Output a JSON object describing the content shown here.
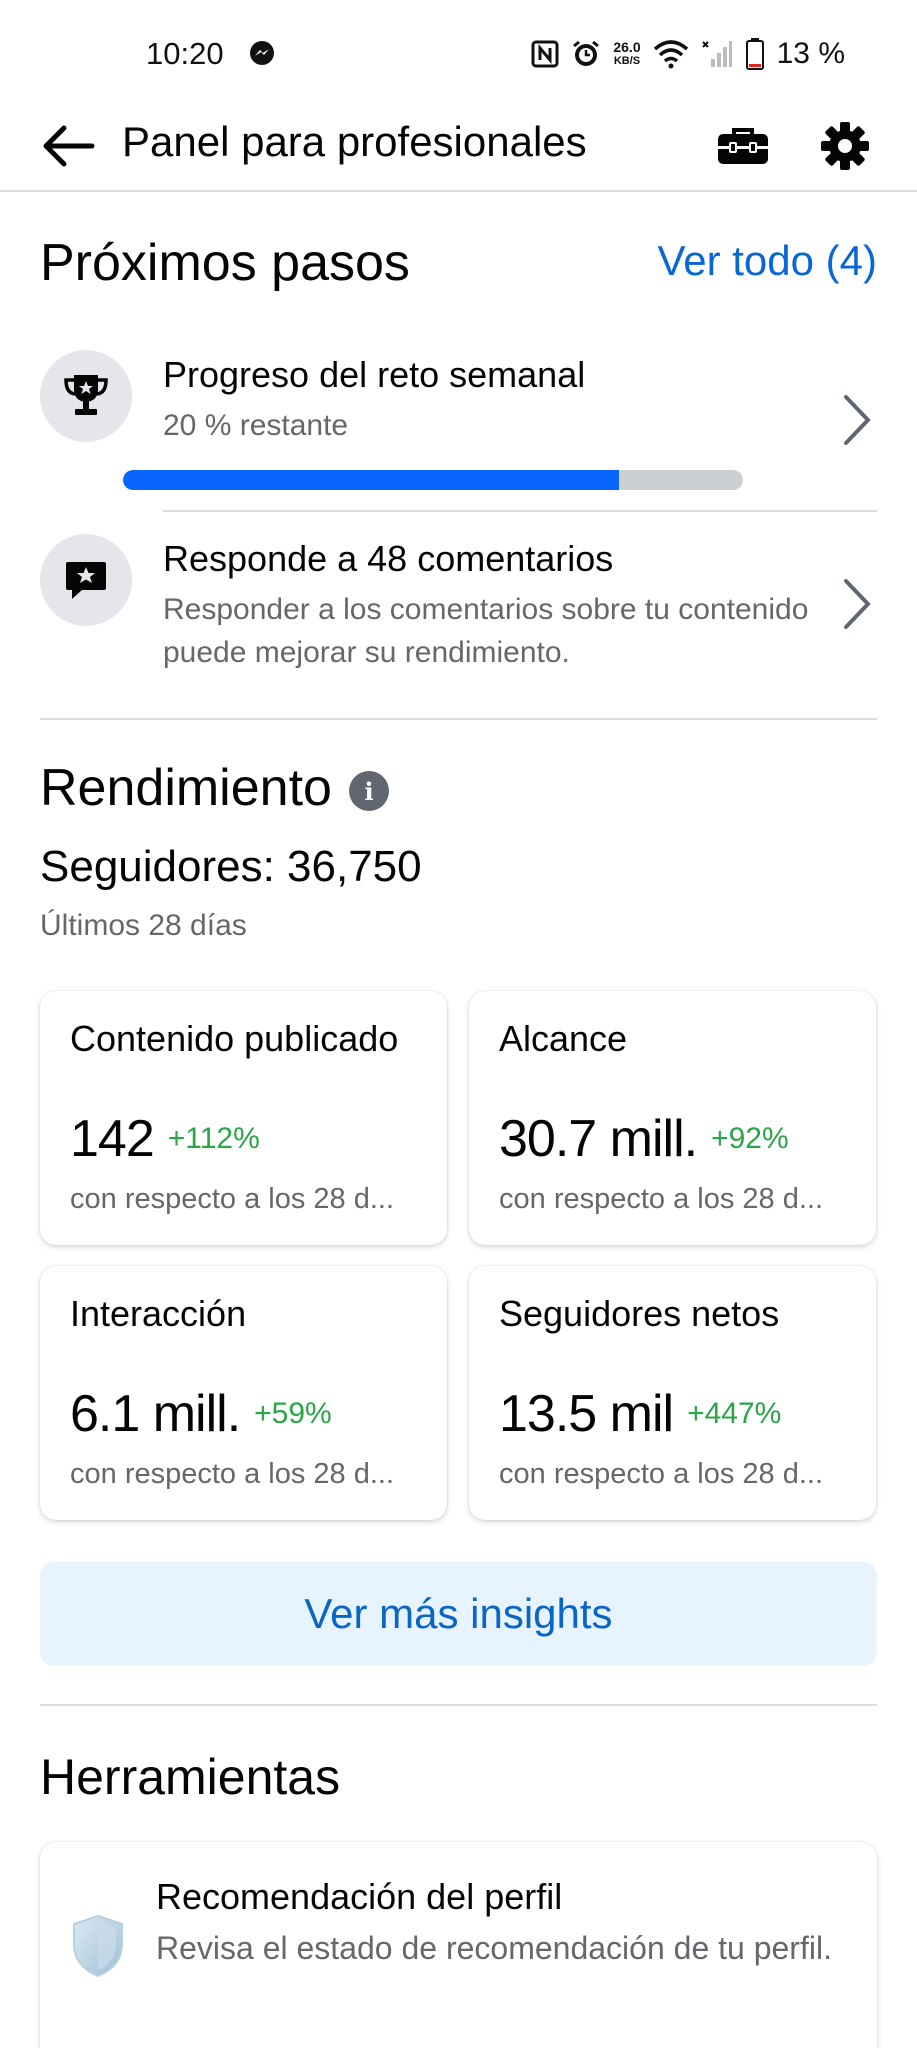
{
  "status_bar": {
    "time": "10:20",
    "network_speed_value": "26.0",
    "network_speed_unit": "KB/S",
    "battery_percent": "13 %"
  },
  "app_bar": {
    "title": "Panel para profesionales"
  },
  "next_steps": {
    "title": "Próximos pasos",
    "see_all": "Ver todo (4)",
    "items": [
      {
        "title": "Progreso del reto semanal",
        "subtitle": "20 % restante",
        "icon": "trophy-icon",
        "progress": 0.8
      },
      {
        "title": "Responde a 48 comentarios",
        "subtitle": "Responder a los comentarios sobre tu contenido puede mejorar su rendimiento.",
        "icon": "comment-star-icon"
      }
    ]
  },
  "performance": {
    "title": "Rendimiento",
    "followers": "Seguidores: 36,750",
    "period": "Últimos 28 días",
    "cards": [
      {
        "label": "Contenido publicado",
        "value": "142",
        "change": "+112%",
        "compare": "con respecto a los 28 d..."
      },
      {
        "label": "Alcance",
        "value": "30.7 mill.",
        "change": "+92%",
        "compare": "con respecto a los 28 d..."
      },
      {
        "label": "Interacción",
        "value": "6.1 mill.",
        "change": "+59%",
        "compare": "con respecto a los 28 d..."
      },
      {
        "label": "Seguidores netos",
        "value": "13.5 mil",
        "change": "+447%",
        "compare": "con respecto a los 28 d..."
      }
    ],
    "more_insights": "Ver más insights"
  },
  "tools": {
    "title": "Herramientas",
    "items": [
      {
        "title": "Recomendación del perfil",
        "subtitle": "Revisa el estado de recomendación de tu perfil.",
        "icon": "shield-icon"
      }
    ]
  },
  "colors": {
    "accent_blue": "#0866ff",
    "link_blue": "#0866d6",
    "positive_green": "#2aa548",
    "secondary_text": "#65676b"
  }
}
